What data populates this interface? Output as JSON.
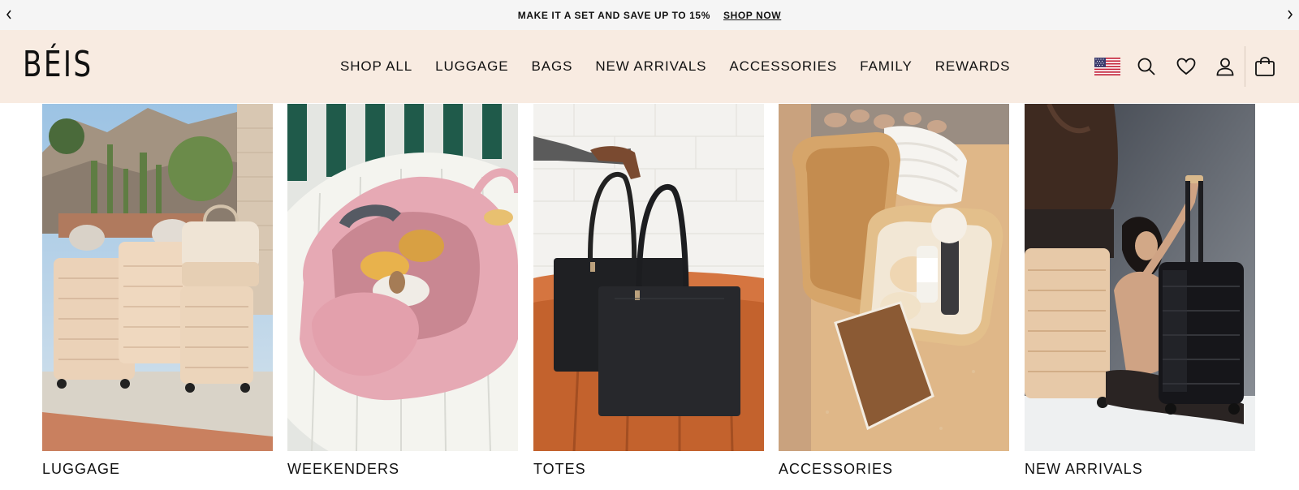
{
  "announcement": {
    "text": "MAKE IT A SET AND SAVE UP TO 15%",
    "link_label": "SHOP NOW"
  },
  "header": {
    "logo": "BÉIS",
    "nav": [
      "SHOP ALL",
      "LUGGAGE",
      "BAGS",
      "NEW ARRIVALS",
      "ACCESSORIES",
      "FAMILY",
      "REWARDS"
    ],
    "icons": [
      "us-flag-icon",
      "search-icon",
      "heart-icon",
      "account-icon",
      "cart-icon"
    ]
  },
  "tiles": [
    {
      "label": "LUGGAGE",
      "image": "beige luggage set outdoors with cacti"
    },
    {
      "label": "WEEKENDERS",
      "image": "open pink weekender bag on white table"
    },
    {
      "label": "TOTES",
      "image": "two black tote bags on orange leather couch"
    },
    {
      "label": "ACCESSORIES",
      "image": "open beige cosmetic case with products"
    },
    {
      "label": "NEW ARRIVALS",
      "image": "model with black and beige luggage"
    }
  ],
  "colors": {
    "announcement_bg": "#f5f5f5",
    "header_bg": "#f8ebe1",
    "text": "#111111"
  }
}
